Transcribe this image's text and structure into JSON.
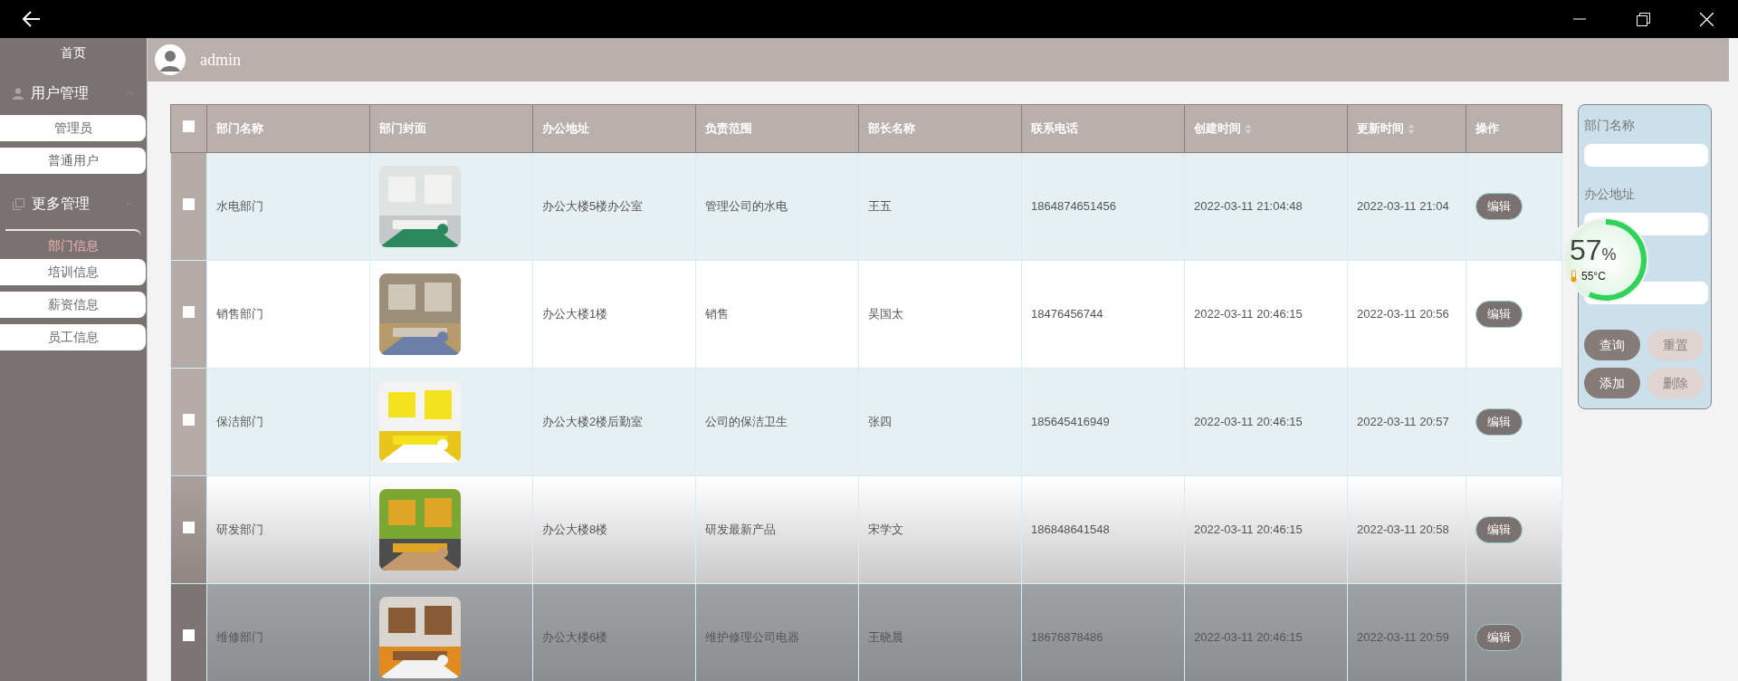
{
  "header": {
    "username": "admin"
  },
  "sidebar": {
    "items": [
      {
        "kind": "link",
        "label": "首页"
      },
      {
        "kind": "group",
        "label": "用户管理",
        "expanded": true,
        "children": [
          {
            "label": "管理员",
            "selected": false
          },
          {
            "label": "普通用户",
            "selected": false
          }
        ]
      },
      {
        "kind": "group",
        "label": "更多管理",
        "expanded": true,
        "children": [
          {
            "label": "部门信息",
            "selected": true
          },
          {
            "label": "培训信息",
            "selected": false
          },
          {
            "label": "薪资信息",
            "selected": false
          },
          {
            "label": "员工信息",
            "selected": false
          }
        ]
      }
    ]
  },
  "table": {
    "all_checked": false,
    "columns": [
      {
        "label": "部门名称",
        "sortable": false
      },
      {
        "label": "部门封面",
        "sortable": false
      },
      {
        "label": "办公地址",
        "sortable": false
      },
      {
        "label": "负责范围",
        "sortable": false
      },
      {
        "label": "部长名称",
        "sortable": false
      },
      {
        "label": "联系电话",
        "sortable": false
      },
      {
        "label": "创建时间",
        "sortable": true
      },
      {
        "label": "更新时间",
        "sortable": true
      },
      {
        "label": "操作",
        "sortable": false
      }
    ],
    "rows": [
      {
        "checked": false,
        "name": "水电部门",
        "address": "办公大楼5楼办公室",
        "scope": "管理公司的水电",
        "head": "王五",
        "phone": "1864874651456",
        "created": "2022-03-11 21:04:48",
        "updated": "2022-03-11 21:04",
        "action": "编辑"
      },
      {
        "checked": false,
        "name": "销售部门",
        "address": "办公大楼1楼",
        "scope": "销售",
        "head": "吴国太",
        "phone": "18476456744",
        "created": "2022-03-11 20:46:15",
        "updated": "2022-03-11 20:56",
        "action": "编辑"
      },
      {
        "checked": false,
        "name": "保洁部门",
        "address": "办公大楼2楼后勤室",
        "scope": "公司的保洁卫生",
        "head": "张四",
        "phone": "185645416949",
        "created": "2022-03-11 20:46:15",
        "updated": "2022-03-11 20:57",
        "action": "编辑"
      },
      {
        "checked": false,
        "name": "研发部门",
        "address": "办公大楼8楼",
        "scope": "研发最新产品",
        "head": "宋学文",
        "phone": "186848641548",
        "created": "2022-03-11 20:46:15",
        "updated": "2022-03-11 20:58",
        "action": "编辑"
      },
      {
        "checked": false,
        "name": "维修部门",
        "address": "办公大楼6楼",
        "scope": "维护修理公司电器",
        "head": "王晓晨",
        "phone": "18676878486",
        "created": "2022-03-11 20:46:15",
        "updated": "2022-03-11 20:59",
        "action": "编辑"
      }
    ]
  },
  "filter": {
    "fields": [
      {
        "kind": "labeled",
        "label": "部门名称"
      },
      {
        "kind": "labeled",
        "label": "办公地址"
      },
      {
        "kind": "bare"
      }
    ],
    "buttons": [
      {
        "label": "查询",
        "disabled": false
      },
      {
        "label": "重置",
        "disabled": true
      },
      {
        "label": "添加",
        "disabled": false
      },
      {
        "label": "删除",
        "disabled": true
      }
    ]
  },
  "monitor": {
    "level": 0.57,
    "percent": "57",
    "unit": "%",
    "temperature": "55°C"
  }
}
